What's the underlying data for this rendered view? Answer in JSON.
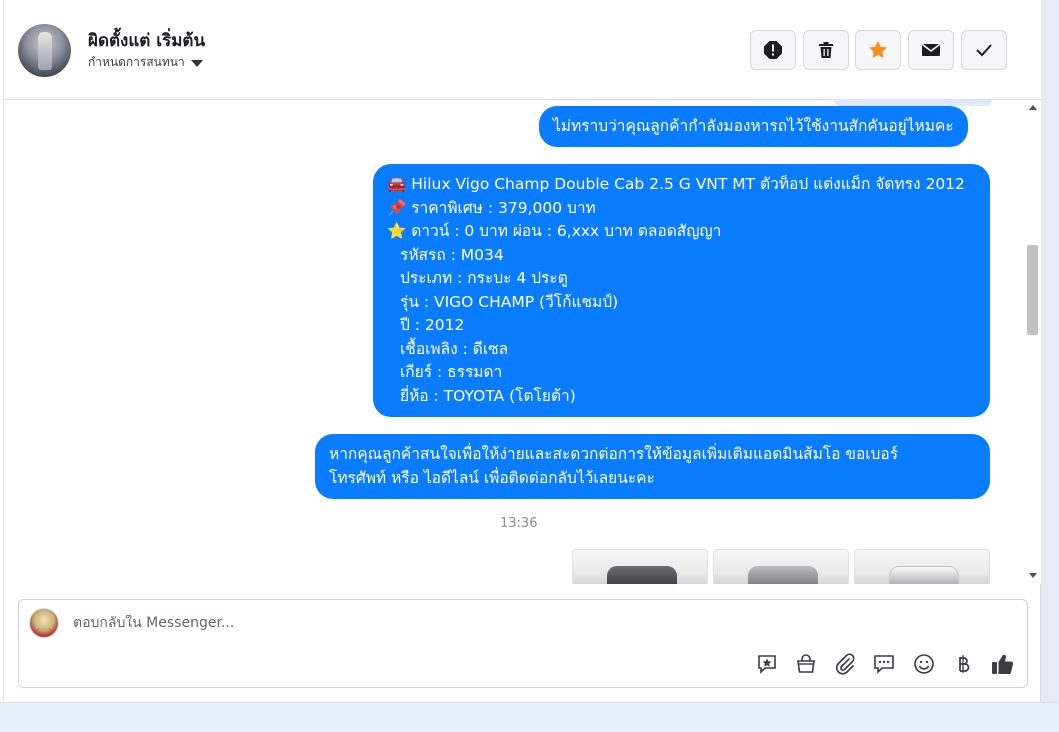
{
  "header": {
    "name": "ผิดตั้งแต่ เริ่มต้น",
    "assign_label": "กำหนดการสนทนา",
    "buttons": [
      "report-icon",
      "trash-icon",
      "star-icon",
      "mail-icon",
      "check-icon"
    ],
    "accent_star": "#f7911e"
  },
  "messages": [
    {
      "lines": [
        "ไม่ทราบว่าคุณลูกค้ากำลังมองหารถไว้ใช้งานสักคันอยู่ไหมคะ"
      ]
    },
    {
      "lines": [
        "🚘 Hilux Vigo Champ Double Cab 2.5 G VNT MT ตัวท็อป แต่งแม็ก จัดทรง 2012",
        "📌 ราคาพิเศษ : 379,000 บาท",
        "⭐ ดาวน์ : 0 บาท ผ่อน : 6,xxx บาท ตลอดสัญญา",
        "รหัสรถ : M034",
        "ประเภท : กระบะ 4 ประตู",
        "รุ่น : VIGO CHAMP (วีโก้แชมป์)",
        "ปี : 2012",
        "เชื้อเพลิง : ดีเซล",
        "เกียร์ : ธรรมดา",
        "ยี่ห้อ : TOYOTA (โตโยต้า)"
      ]
    },
    {
      "lines": [
        "หากคุณลูกค้าสนใจเพื่อให้ง่ายและสะดวกต่อการให้ข้อมูลเพิ่มเติมแอดมินส้มโอ ขอเบอร์",
        "โทรศัพท์ หรือ ไอดีไลน์ เพื่อติดต่อกลับไว้เลยนะคะ"
      ]
    }
  ],
  "timestamp": "13:36",
  "photos": [
    "car-photo-1",
    "car-photo-2",
    "car-photo-3"
  ],
  "composer": {
    "placeholder": "ตอบกลับใน Messenger...",
    "tools": [
      "saved-reply-icon",
      "shop-icon",
      "attach-icon",
      "comment-icon",
      "emoji-icon",
      "baht-icon",
      "like-icon"
    ]
  },
  "colors": {
    "bubble": "#0a7cff",
    "bubble_text": "#ffffff"
  }
}
